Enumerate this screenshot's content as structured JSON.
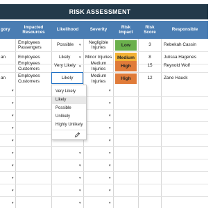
{
  "title": "RISK ASSESSMENT",
  "headers": [
    "gory",
    "Impacted Resources",
    "Likelihood",
    "Severity",
    "Risk Impact",
    "Risk Score",
    "Responsible"
  ],
  "rows": [
    {
      "category": "",
      "resources": "Employees Passengers",
      "likelihood": "Possible",
      "severity": "Negligible Injuries",
      "impact": "Low",
      "score": "3",
      "responsible": "Rebekah Cassin"
    },
    {
      "category": "an",
      "resources": "Employees",
      "likelihood": "Likely",
      "severity": "Minor Injuries",
      "impact": "Medium",
      "score": "8",
      "responsible": "Julissa Hagenes"
    },
    {
      "category": "",
      "resources": "Employees Customers",
      "likelihood": "Very Likely",
      "severity": "Medium Injuries",
      "impact": "High",
      "score": "15",
      "responsible": "Reynold Wolf"
    },
    {
      "category": "an",
      "resources": "Employees Customers",
      "likelihood": "Likely",
      "severity": "Medium Injuries",
      "impact": "High",
      "score": "12",
      "responsible": "Zane Hauck"
    }
  ],
  "impact_colors": {
    "Low": "#6ab04c",
    "Medium": "#f2b134",
    "High": "#e07b39"
  },
  "editing_value": "Likely",
  "dropdown": {
    "options": [
      "Very Likely",
      "Likely",
      "Possible",
      "Unlikely",
      "Highly Unlikely"
    ],
    "hovered": "Likely",
    "footer_icon": "pencil-icon"
  },
  "colors": {
    "title_bg": "#233a4a",
    "header_bg": "#4a7db3",
    "selection": "#1e6fc4"
  }
}
